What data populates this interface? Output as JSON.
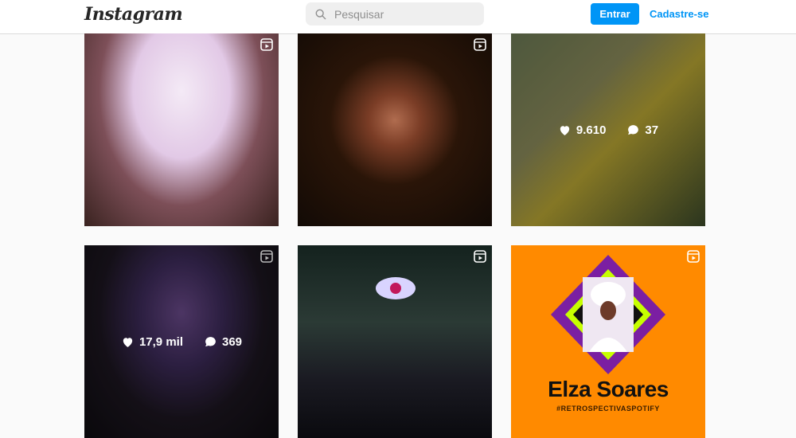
{
  "header": {
    "logo": "Instagram",
    "search_placeholder": "Pesquisar",
    "login_label": "Entrar",
    "signup_label": "Cadastre-se"
  },
  "grid": {
    "tiles": [
      {
        "reel": true,
        "likes": "",
        "comments": ""
      },
      {
        "reel": true,
        "likes": "",
        "comments": ""
      },
      {
        "reel": false,
        "likes": "9.610",
        "comments": "37"
      },
      {
        "reel": true,
        "likes": "17,9 mil",
        "comments": "369"
      },
      {
        "reel": true,
        "likes": "",
        "comments": ""
      },
      {
        "reel": true,
        "likes": "",
        "comments": "",
        "title": "Elza Soares",
        "subtitle": "#RETROSPECTIVASPOTIFY"
      }
    ]
  },
  "colors": {
    "accent": "#0095f6",
    "tile6_bg": "#ff8a00"
  }
}
